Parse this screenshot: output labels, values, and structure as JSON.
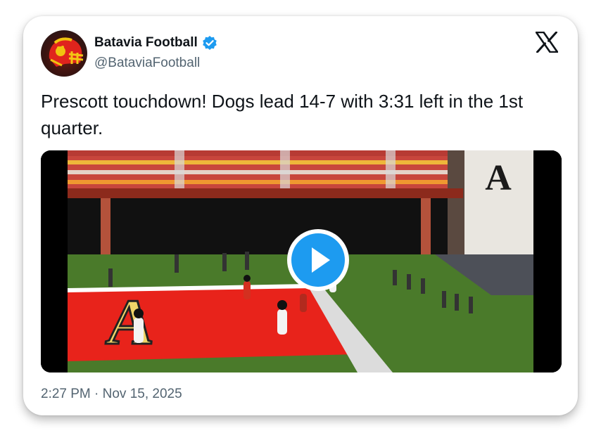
{
  "author": {
    "name": "Batavia Football",
    "handle": "@BataviaFootball",
    "verified": true
  },
  "tweet": {
    "text": "Prescott touchdown! Dogs lead 14-7 with 3:31 left in the 1st quarter.",
    "timestamp": "2:27 PM · Nov 15, 2025"
  },
  "media": {
    "type": "video",
    "end_zone_letter": "A",
    "stadium_letter": "A"
  },
  "icons": {
    "platform": "x-logo-icon",
    "verified": "verified-badge-icon",
    "play": "play-icon"
  },
  "colors": {
    "verified_blue": "#1d9bf0",
    "play_blue": "#1d9bf0",
    "text_primary": "#0f1419",
    "text_secondary": "#536471",
    "end_zone_red": "#e8231b",
    "field_green": "#4a7a2a"
  }
}
